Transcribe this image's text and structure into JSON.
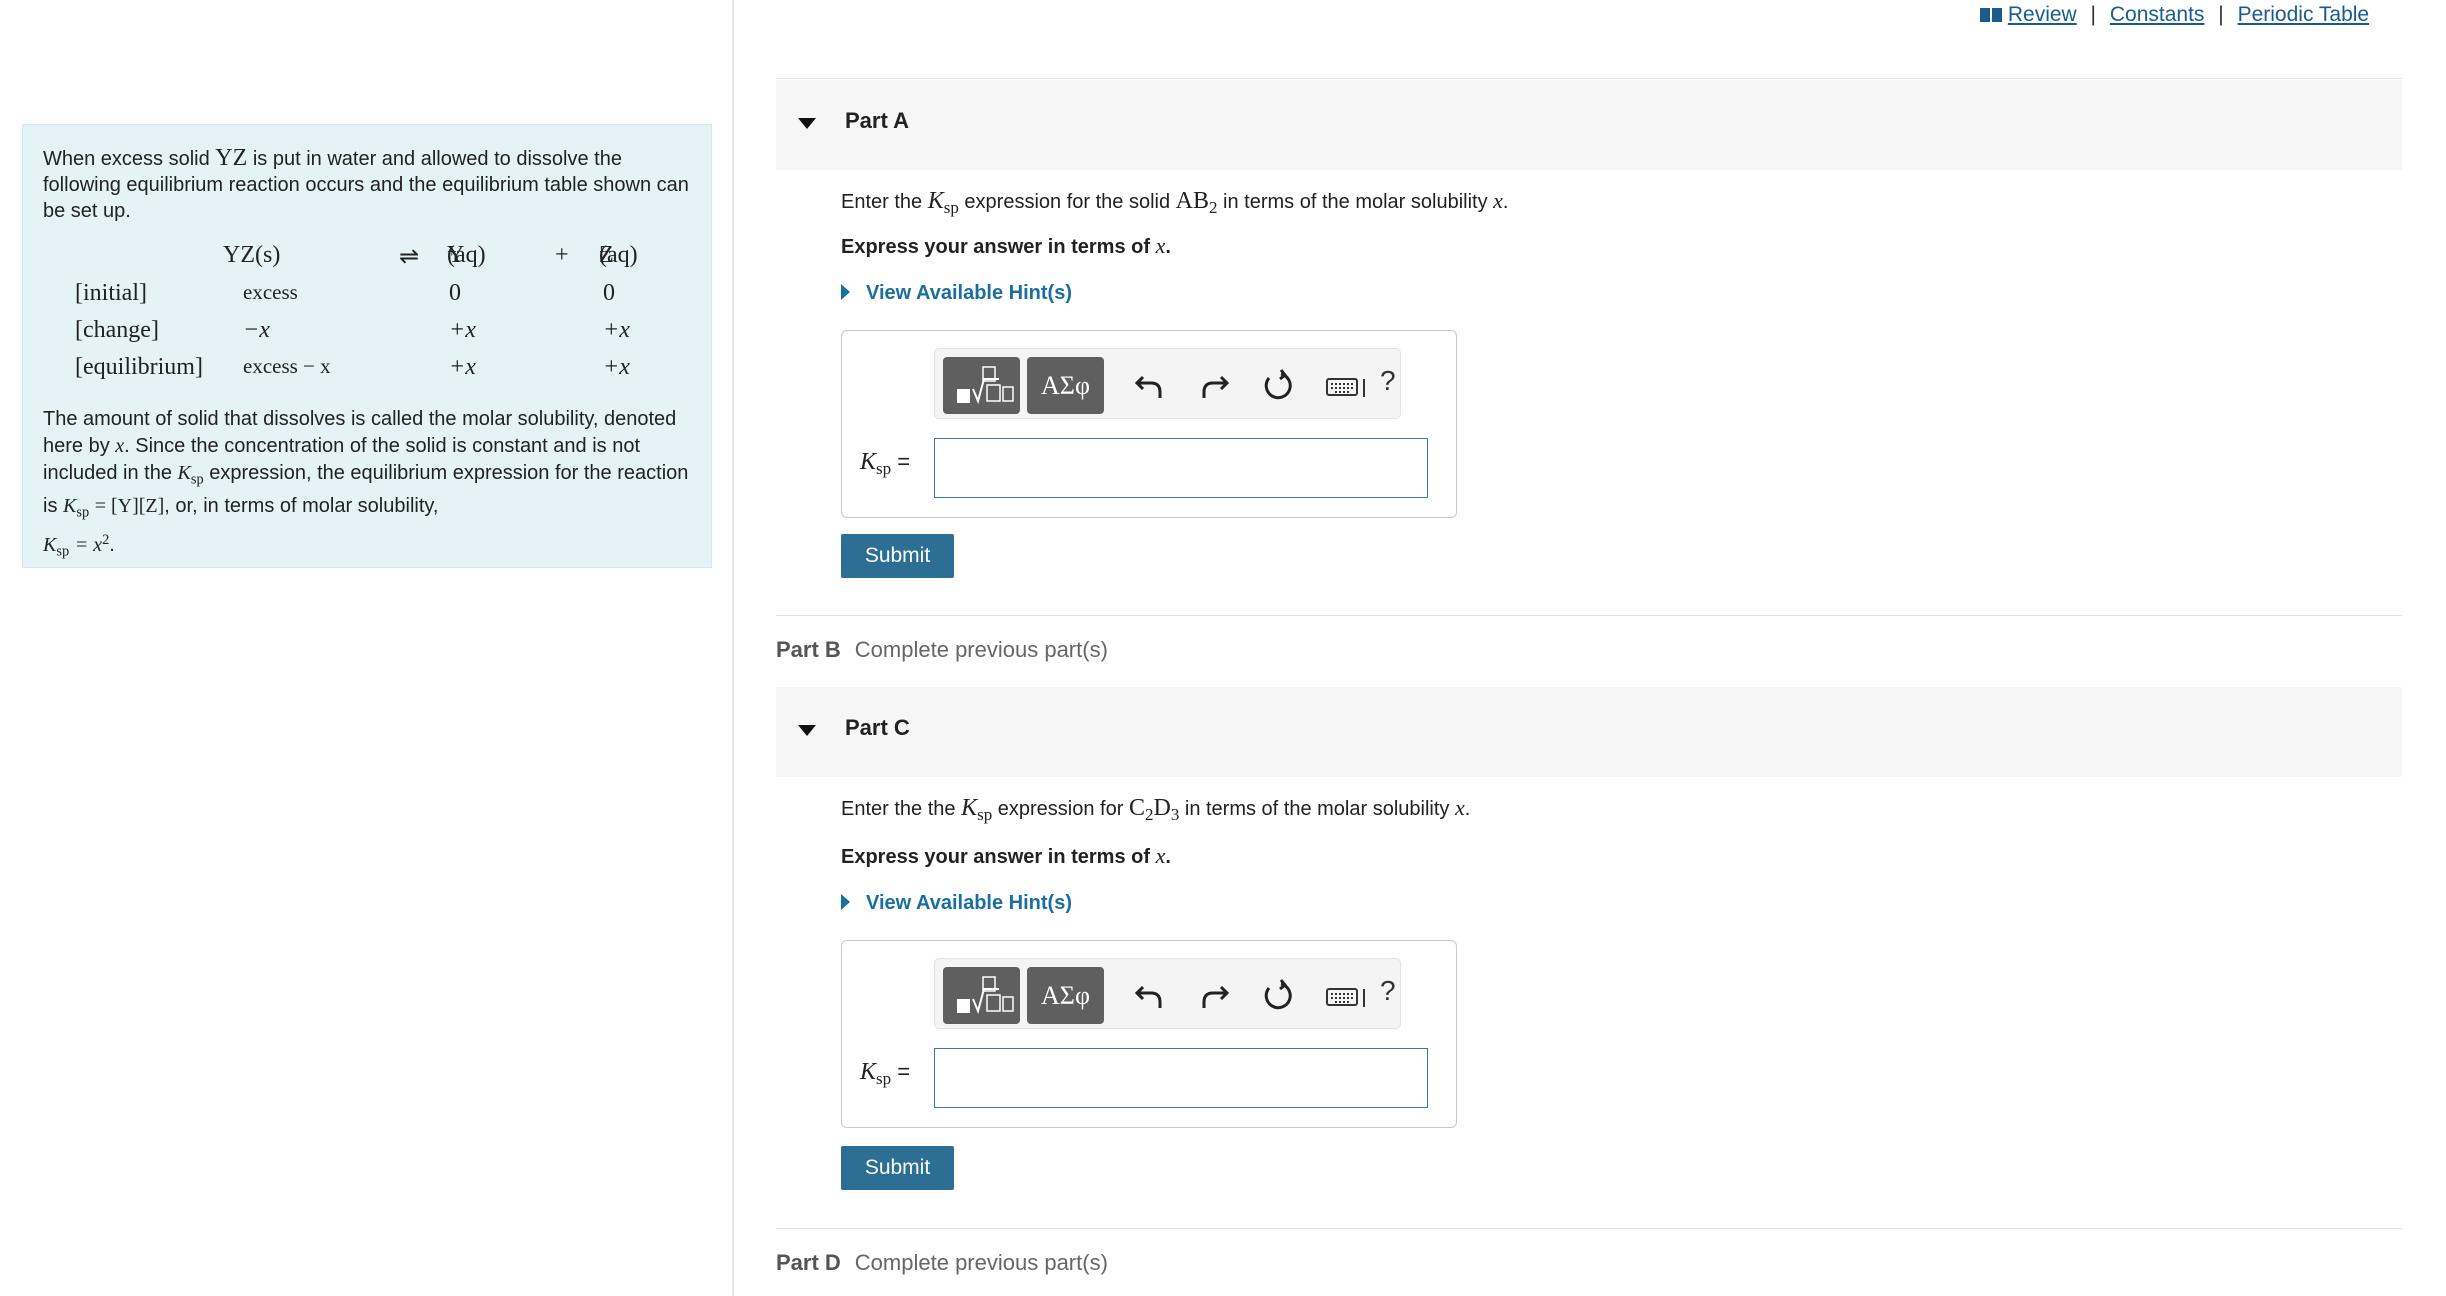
{
  "top_links": {
    "review": "Review",
    "constants": "Constants",
    "periodic_table": "Periodic Table",
    "separator": "|"
  },
  "intro": {
    "text_before": "When excess solid ",
    "compound": "YZ",
    "text_after": " is put in water and allowed to dissolve the following equilibrium reaction occurs and the equilibrium table shown can be set up."
  },
  "equilibrium_table": {
    "reaction": {
      "reactant": "YZ(s)",
      "arrow": "⇌",
      "product1": "Y",
      "product1_charge": "+",
      "product1_state": "(aq)",
      "plus": "+",
      "product2": "Z",
      "product2_charge": "−",
      "product2_state": "(aq)"
    },
    "rows": [
      {
        "label": "[initial]",
        "c1": "excess",
        "c2": "0",
        "c3": "0"
      },
      {
        "label": "[change]",
        "c1": "−x",
        "c2": "+x",
        "c3": "+x"
      },
      {
        "label": "[equilibrium]",
        "c1": "excess − x",
        "c2": "+x",
        "c3": "+x"
      }
    ]
  },
  "description": {
    "p1": "The amount of solid that dissolves is called the molar solubility, denoted here by ",
    "var": "x",
    "p2": ". Since the concentration of the solid is constant and is not included in the ",
    "ksp_K": "K",
    "ksp_sub": "sp",
    "p3": " expression, the equilibrium expression for the reaction is ",
    "expr": "= [Y][Z]",
    "p4": ", or, in terms of molar solubility,",
    "final_expr": "= x",
    "final_sup": "2",
    "final_end": "."
  },
  "part_a": {
    "title": "Part A",
    "prompt_1": "Enter the ",
    "prompt_2": " expression for the solid ",
    "compound": "AB",
    "compound_sub": "2",
    "prompt_3": " in terms of the molar solubility ",
    "prompt_var": "x",
    "prompt_end": ".",
    "instruction": "Express your answer in terms of ",
    "instruction_var": "x",
    "instruction_end": ".",
    "hint": "View Available Hint(s)",
    "label_K": "K",
    "label_sub": "sp",
    "label_eq": "=",
    "input_value": "",
    "submit": "Submit"
  },
  "part_b": {
    "title": "Part B",
    "status": "Complete previous part(s)"
  },
  "part_c": {
    "title": "Part C",
    "prompt_1": "Enter the the ",
    "prompt_2": " expression for ",
    "compound_a": "C",
    "compound_a_sub": "2",
    "compound_b": "D",
    "compound_b_sub": "3",
    "prompt_3": " in terms of the molar solubility ",
    "prompt_var": "x",
    "prompt_end": ".",
    "instruction": "Express your answer in terms of ",
    "instruction_var": "x",
    "instruction_end": ".",
    "hint": "View Available Hint(s)",
    "label_K": "K",
    "label_sub": "sp",
    "label_eq": "=",
    "input_value": "",
    "submit": "Submit"
  },
  "part_d": {
    "title": "Part D",
    "status": "Complete previous part(s)"
  },
  "toolbar": {
    "greek_label": "ΑΣφ",
    "help_label": "?"
  },
  "icons": [
    "book-icon",
    "template-icon",
    "undo-icon",
    "redo-icon",
    "reset-icon",
    "keyboard-icon",
    "help-icon",
    "collapse-caret-icon",
    "hint-expand-icon"
  ],
  "colors": {
    "accent": "#2d6f94",
    "link": "#1a5b8e",
    "panel_bg": "#e4f3f5",
    "toolbar_btn": "#5f5f5f"
  }
}
